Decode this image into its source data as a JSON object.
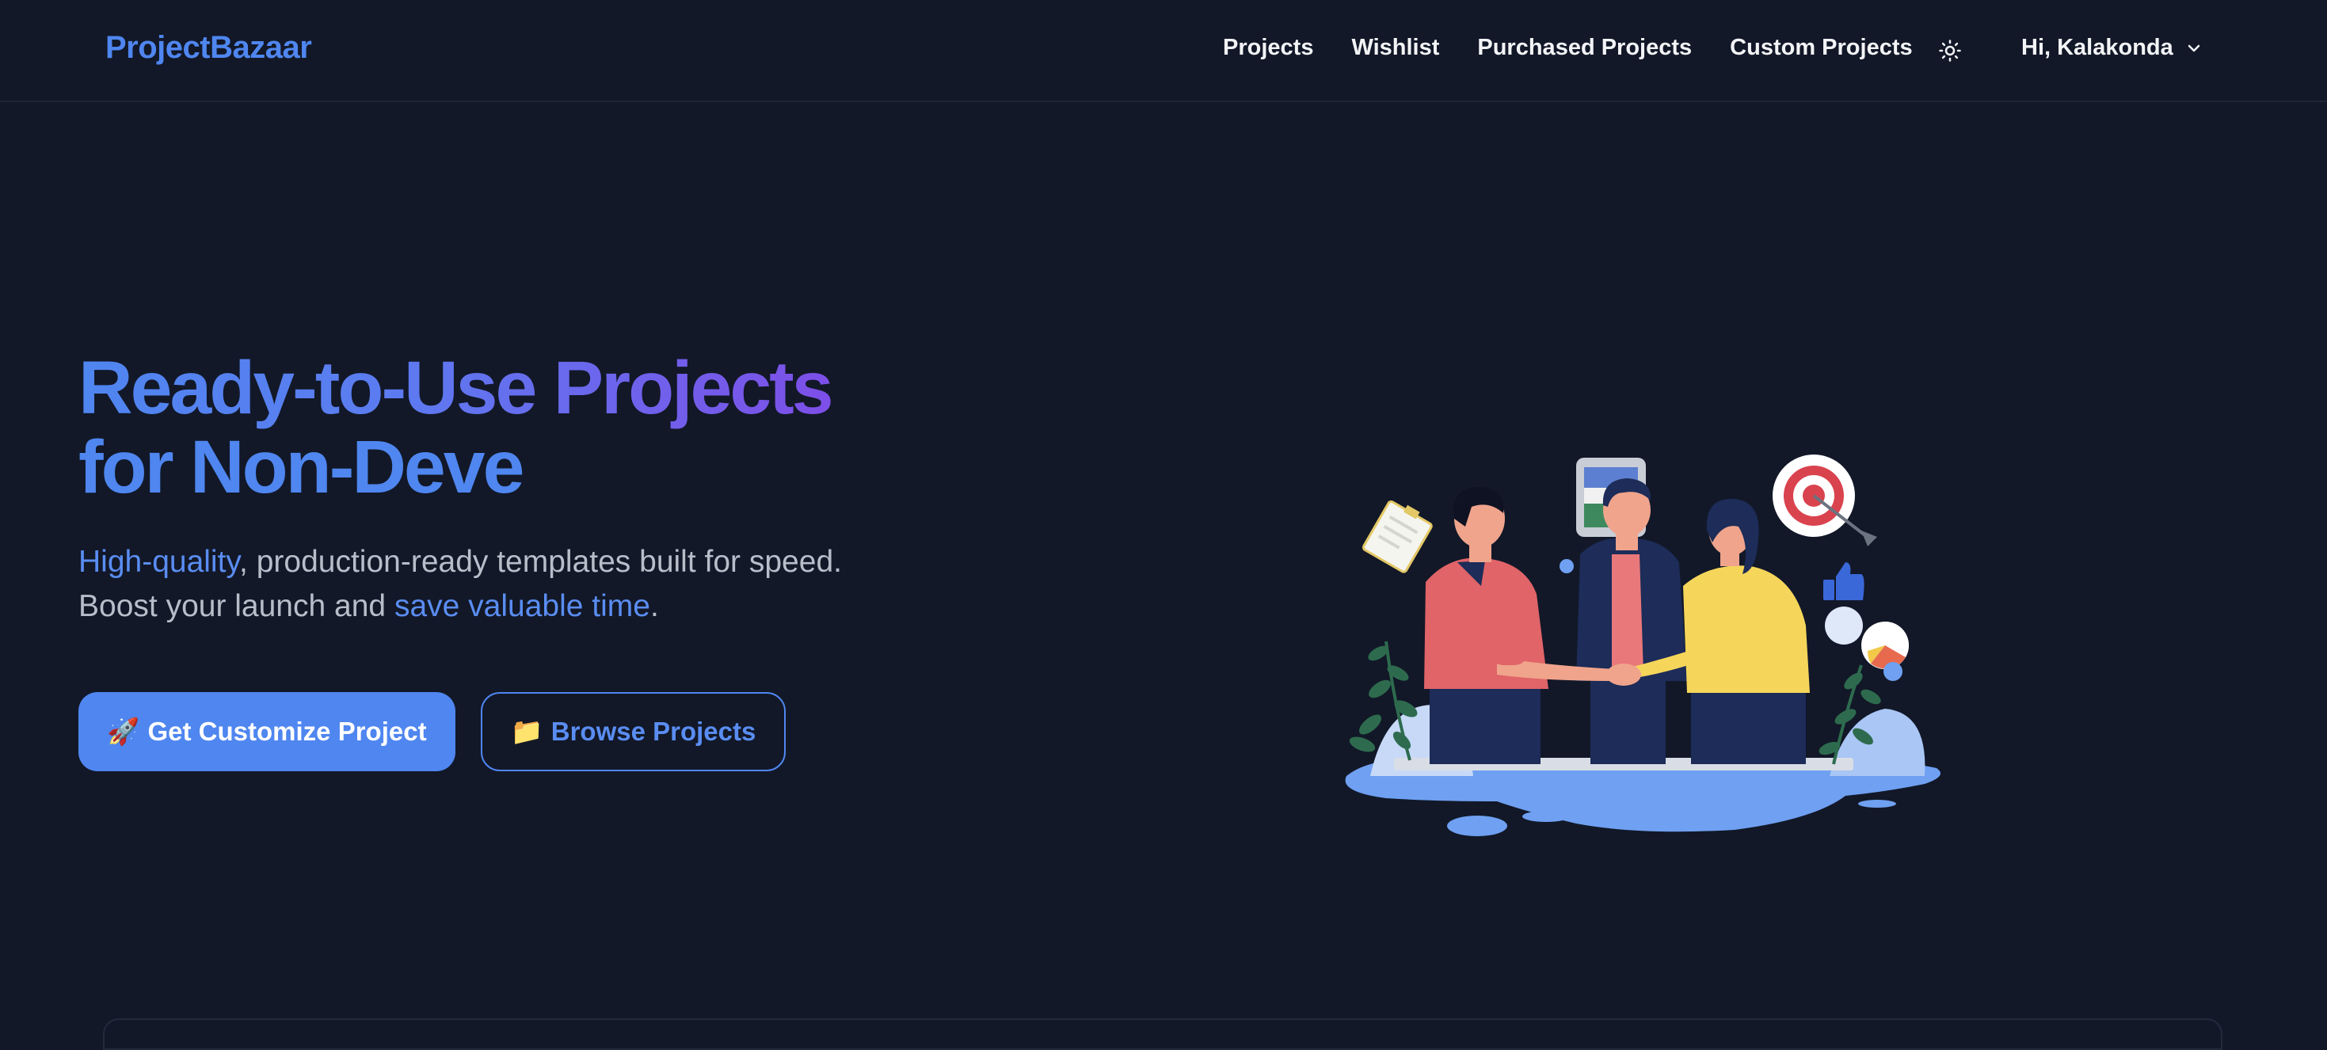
{
  "brand": {
    "name": "ProjectBazaar"
  },
  "nav": {
    "links": [
      {
        "label": "Projects"
      },
      {
        "label": "Wishlist"
      },
      {
        "label": "Purchased Projects"
      },
      {
        "label": "Custom Projects"
      }
    ],
    "theme_icon": "sun-icon",
    "user_greeting": "Hi, Kalakonda",
    "user_chevron": "chevron-down-icon"
  },
  "hero": {
    "title_part1": "Ready-to-Use Projects",
    "title_part2": "for Non-Deve",
    "subtitle": {
      "hl1": "High-quality",
      "text1": ", production-ready templates built for speed.",
      "text2": "Boost your launch and ",
      "hl2": "save valuable time",
      "text3": "."
    },
    "primary_button": {
      "icon": "🚀",
      "label": "Get Customize Project"
    },
    "secondary_button": {
      "icon": "📁",
      "label": "Browse Projects"
    }
  },
  "colors": {
    "background": "#121828",
    "accent": "#4f86f0",
    "accent_purple": "#7d4fe8",
    "text": "#f3f4f6",
    "muted": "#b8bec9"
  }
}
